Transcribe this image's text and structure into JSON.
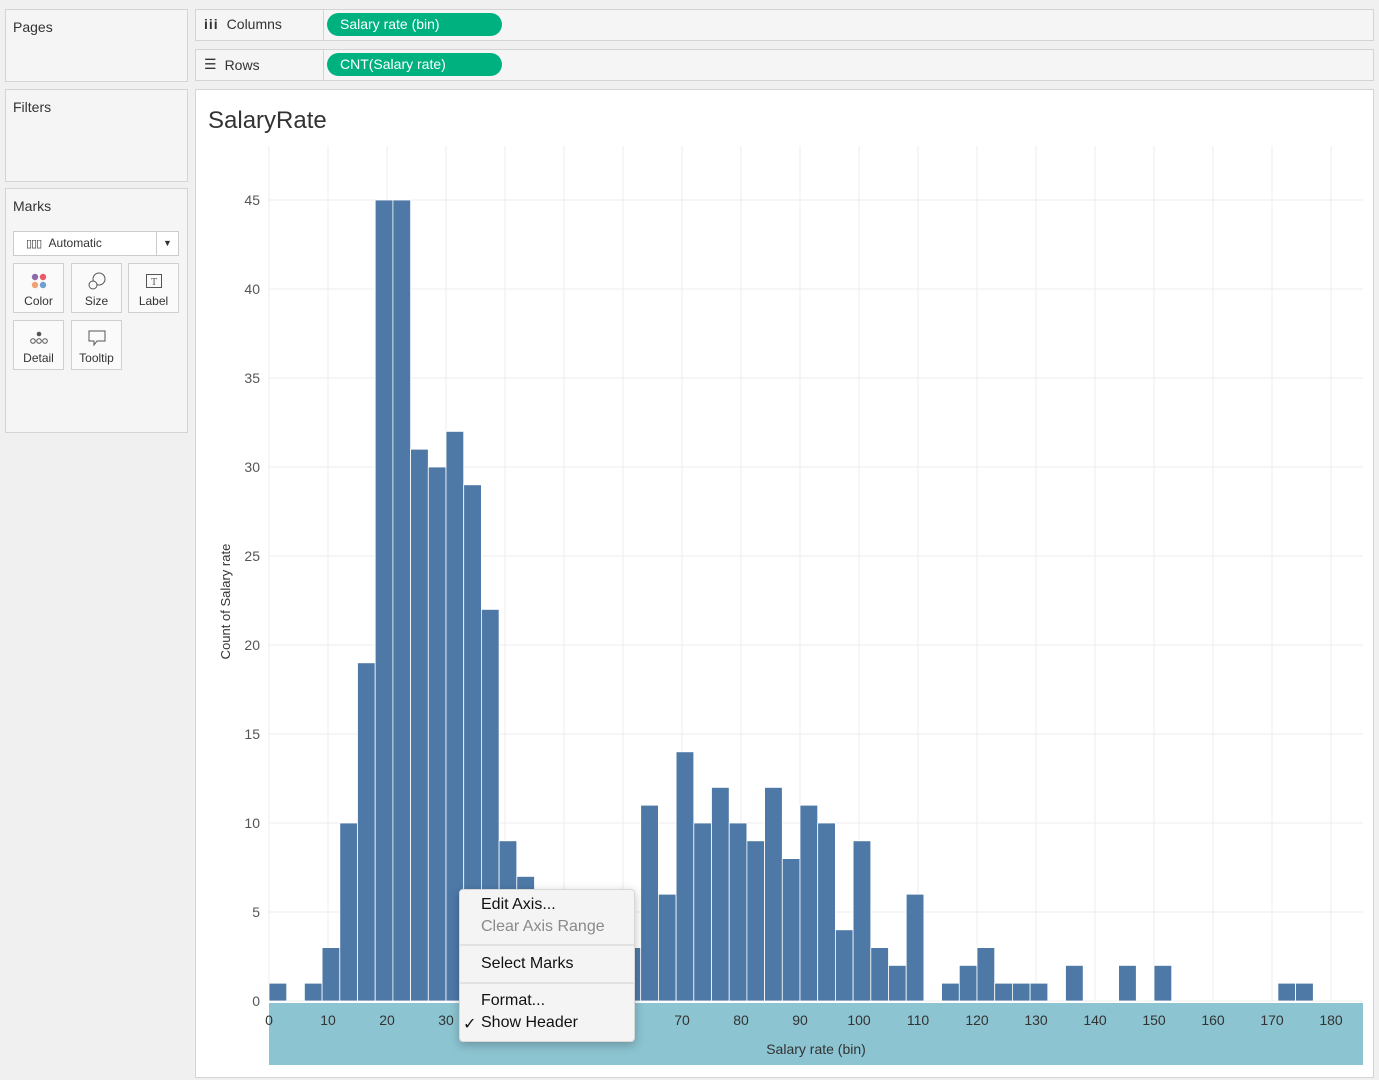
{
  "pages": {
    "title": "Pages"
  },
  "filters": {
    "title": "Filters"
  },
  "marks": {
    "title": "Marks",
    "type": "Automatic",
    "buttons": [
      {
        "label": "Color",
        "icon": "color-dots-icon"
      },
      {
        "label": "Size",
        "icon": "size-circles-icon"
      },
      {
        "label": "Label",
        "icon": "label-text-icon"
      },
      {
        "label": "Detail",
        "icon": "detail-dots-icon"
      },
      {
        "label": "Tooltip",
        "icon": "tooltip-bubble-icon"
      }
    ]
  },
  "shelves": {
    "columns": {
      "label": "Columns",
      "pill": "Salary rate (bin)"
    },
    "rows": {
      "label": "Rows",
      "pill": "CNT(Salary rate)"
    }
  },
  "context_menu": {
    "items": [
      {
        "label": "Edit Axis...",
        "enabled": true
      },
      {
        "label": "Clear Axis Range",
        "enabled": false
      },
      {
        "label": "Select Marks",
        "enabled": true
      },
      {
        "label": "Format...",
        "enabled": true
      },
      {
        "label": "Show Header",
        "enabled": true,
        "checked": true
      }
    ]
  },
  "colors": {
    "bar": "#4e79a7",
    "pill": "#00b180",
    "axis_highlight": "#8cc4d1"
  },
  "chart_data": {
    "type": "bar",
    "title": "SalaryRate",
    "xlabel": "Salary rate (bin)",
    "ylabel": "Count of Salary rate",
    "bin_size": 3,
    "xlim": [
      0,
      185
    ],
    "ylim": [
      0,
      48
    ],
    "xticks": [
      0,
      10,
      20,
      30,
      40,
      50,
      60,
      70,
      80,
      90,
      100,
      110,
      120,
      130,
      140,
      150,
      160,
      170,
      180
    ],
    "yticks": [
      0,
      5,
      10,
      15,
      20,
      25,
      30,
      35,
      40,
      45
    ],
    "grid": true,
    "bins": [
      0,
      6,
      9,
      12,
      15,
      18,
      21,
      24,
      27,
      30,
      33,
      36,
      39,
      42,
      60,
      63,
      66,
      69,
      72,
      75,
      78,
      81,
      84,
      87,
      90,
      93,
      96,
      99,
      102,
      105,
      108,
      114,
      117,
      120,
      123,
      126,
      129,
      135,
      144,
      150,
      171,
      174
    ],
    "values": [
      1,
      1,
      3,
      10,
      19,
      45,
      45,
      31,
      30,
      32,
      29,
      22,
      9,
      7,
      3,
      11,
      6,
      14,
      10,
      12,
      10,
      9,
      12,
      8,
      11,
      10,
      4,
      9,
      3,
      2,
      6,
      1,
      2,
      3,
      1,
      1,
      1,
      2,
      2,
      2,
      1,
      1
    ]
  }
}
